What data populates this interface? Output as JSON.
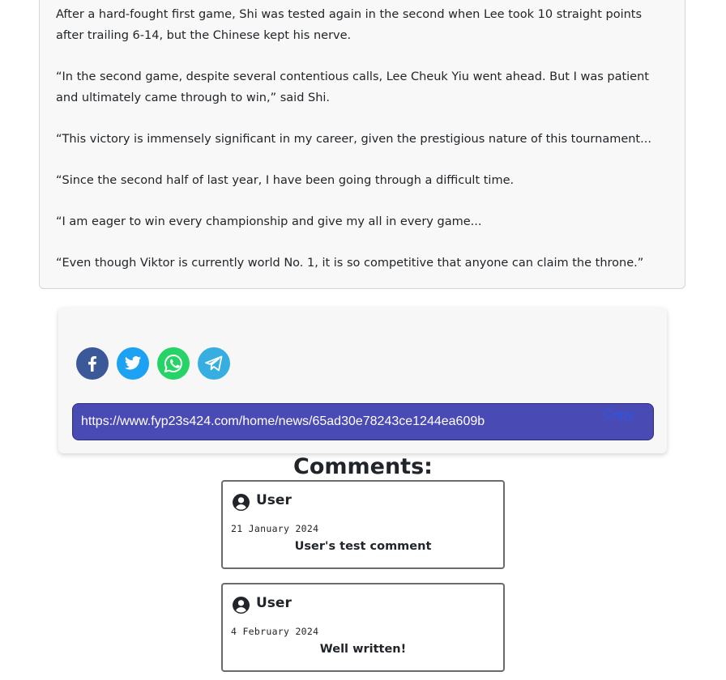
{
  "article": {
    "paragraphs": [
      "After a hard-fought first game, Shi was tested again in the second when Lee took 10 straight points after trailing 6-14, but the Chinese kept his nerve.",
      "“In the second game, despite several contentious calls, Lee Cheuk Yiu went ahead. But I was patient and ultimately came through to win,” said Shi.",
      "“This victory is immensely significant in my career, given the prestigious nature of this tournament...",
      "“Since the second half of last year, I have been going through a difficult time.",
      "“I am eager to win every championship and give my all in every game...",
      "“Even though Viktor is currently world No. 1, it is so competitive that anyone can claim the throne.”"
    ]
  },
  "share": {
    "icons": [
      "facebook-icon",
      "twitter-icon",
      "whatsapp-icon",
      "telegram-icon"
    ],
    "colors": {
      "facebook": "#3b5998",
      "twitter": "#1da1f2",
      "whatsapp": "#25d366",
      "telegram": "#37aee2",
      "url_bar": "#4a4ab4"
    },
    "url": "https://www.fyp23s424.com/home/news/65ad30e78243ce1244ea609b",
    "copy_label": "Copy"
  },
  "comments": {
    "title": "Comments:",
    "items": [
      {
        "user": "User",
        "date": "21 January 2024",
        "text": "User's test comment"
      },
      {
        "user": "User",
        "date": "4 February 2024",
        "text": "Well written!"
      }
    ]
  }
}
